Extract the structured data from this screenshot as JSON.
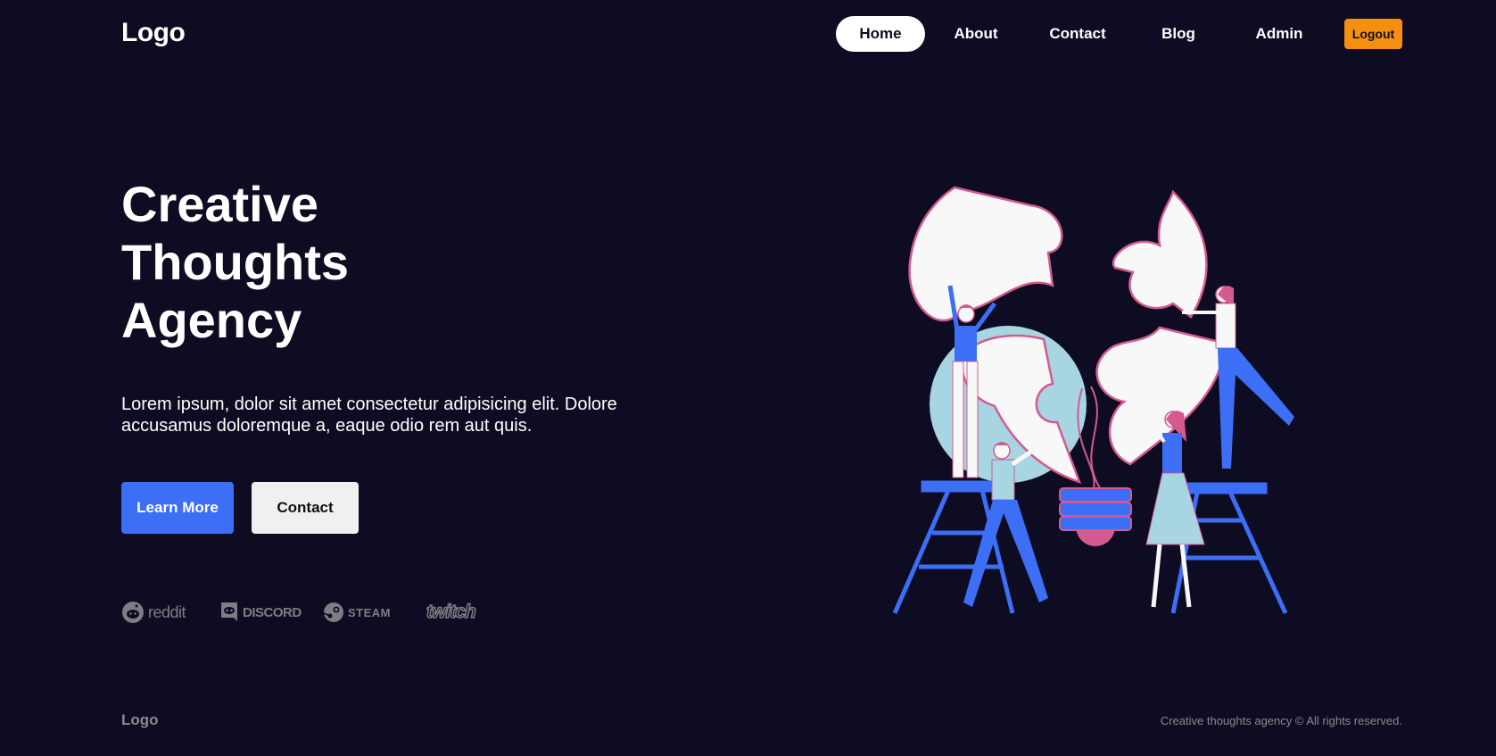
{
  "header": {
    "logo": "Logo",
    "nav": [
      {
        "label": "Home",
        "active": true
      },
      {
        "label": "About",
        "active": false
      },
      {
        "label": "Contact",
        "active": false
      },
      {
        "label": "Blog",
        "active": false
      },
      {
        "label": "Admin",
        "active": false
      }
    ],
    "logout_label": "Logout"
  },
  "hero": {
    "title_lines": [
      "Creative",
      "Thoughts",
      "Agency"
    ],
    "description": "Lorem ipsum, dolor sit amet consectetur adipisicing elit. Dolore accusamus doloremque a, eaque odio rem aut quis.",
    "primary_button": "Learn More",
    "secondary_button": "Contact"
  },
  "brands": [
    {
      "name": "reddit",
      "icon": "reddit-icon"
    },
    {
      "name": "DISCORD",
      "icon": "discord-icon"
    },
    {
      "name": "STEAM",
      "icon": "steam-icon"
    },
    {
      "name": "twitch",
      "icon": "twitch-icon"
    }
  ],
  "footer": {
    "logo": "Logo",
    "copyright": "Creative thoughts agency © All rights reserved."
  },
  "colors": {
    "background": "#0d0c22",
    "primary": "#3c6ef6",
    "logout": "#f68e0f",
    "muted": "#8a8a8f",
    "illustration_pink": "#d45a8f",
    "illustration_blue": "#3c6ef6",
    "illustration_light": "#a7d5e1"
  }
}
